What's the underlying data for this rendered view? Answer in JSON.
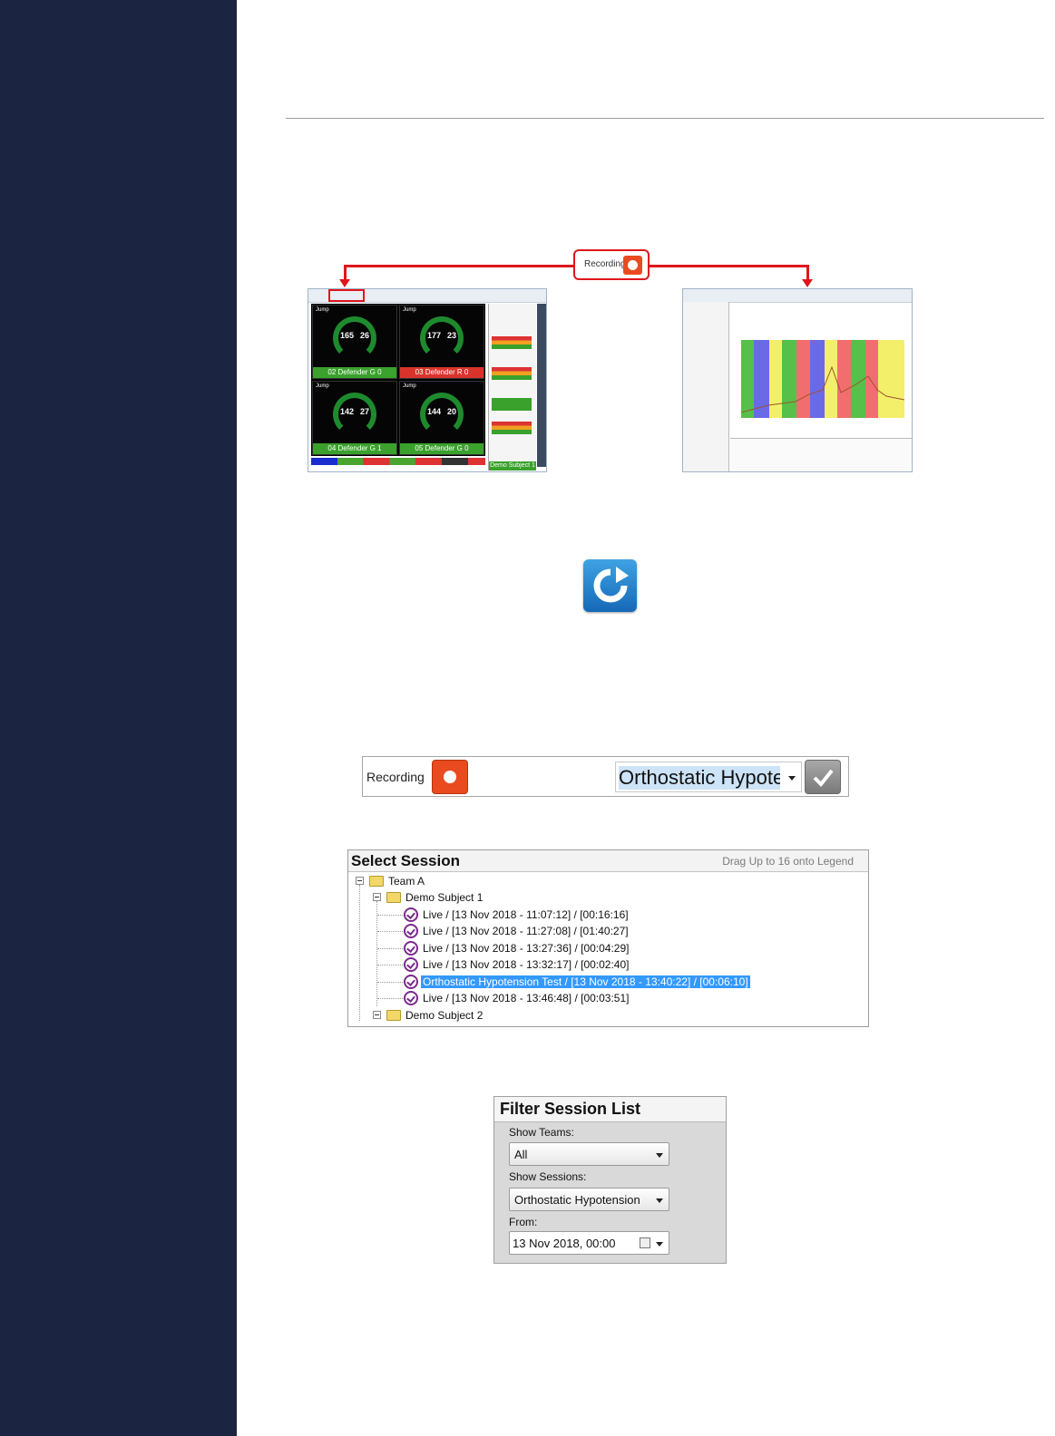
{
  "diagram": {
    "recording_label": "Recording"
  },
  "live_thumbnail": {
    "tiles": [
      {
        "header": "Jump",
        "hr": "165",
        "br": "26",
        "name": "02 Defender",
        "code": "G 0",
        "color": "#3aa12c"
      },
      {
        "header": "Jump",
        "hr": "177",
        "br": "23",
        "name": "03 Defender",
        "code": "R 0",
        "color": "#d9342b"
      },
      {
        "header": "Jump",
        "hr": "142",
        "br": "27",
        "name": "04 Defender",
        "code": "G 1",
        "color": "#3aa12c"
      },
      {
        "header": "Jump",
        "hr": "144",
        "br": "20",
        "name": "05 Defender",
        "code": "G 0",
        "color": "#3aa12c"
      }
    ],
    "side_label": "Demo Subject 1"
  },
  "toolbar": {
    "recording_label": "Recording",
    "session_value": "Orthostatic Hypotension Test"
  },
  "select_session": {
    "title": "Select Session",
    "hint": "Drag Up to 16 onto Legend",
    "team": "Team A",
    "subject1": "Demo Subject 1",
    "sessions": [
      "Live / [13 Nov 2018 - 11:07:12] / [00:16:16]",
      "Live / [13 Nov 2018 - 11:27:08] / [01:40:27]",
      "Live / [13 Nov 2018 - 13:27:36] / [00:04:29]",
      "Live / [13 Nov 2018 - 13:32:17] / [00:02:40]",
      "Orthostatic Hypotension Test / [13 Nov 2018 - 13:40:22] / [00:06:10]",
      "Live / [13 Nov 2018 - 13:46:48] / [00:03:51]"
    ],
    "subject2": "Demo Subject 2"
  },
  "filter": {
    "title": "Filter Session List",
    "teams_label": "Show Teams:",
    "teams_value": "All",
    "sessions_label": "Show Sessions:",
    "sessions_value": "Orthostatic Hypotension",
    "from_label": "From:",
    "from_value": "13 Nov 2018, 00:00"
  },
  "colors": {
    "sidebar": "#1b2440",
    "accent_red": "#e0161c",
    "record_orange": "#ea4a1f",
    "selection_blue": "#3399ff"
  }
}
